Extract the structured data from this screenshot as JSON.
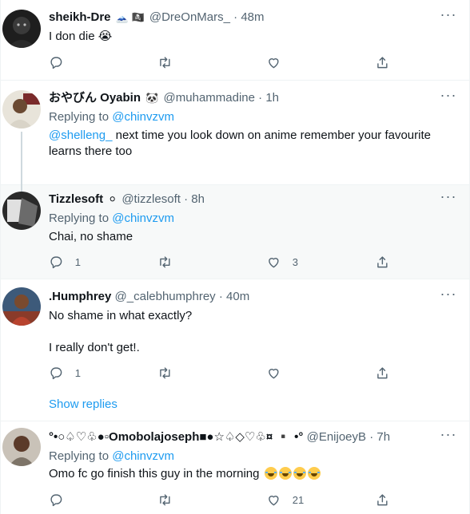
{
  "tweets": [
    {
      "name": "sheikh-Dre",
      "badges": "🗻 🏴‍☠️",
      "handle": "@DreOnMars_",
      "time": "48m",
      "lines": [
        "I don die 😭"
      ],
      "replies": "",
      "retweets": "",
      "likes": ""
    },
    {
      "name": "おやびん Oyabin",
      "badges": "🐼",
      "handle": "@muhammadine",
      "time": "1h",
      "replying_label": "Replying to",
      "replying_to": "@chinvzvm",
      "mention": "@shelleng_",
      "text_line1": " next time you look down on anime remember your favourite",
      "text_line2": "learns there too",
      "replies": "",
      "retweets": "",
      "likes": ""
    },
    {
      "name": "Tizzlesoft",
      "badges": "⚪",
      "handle": "@tizzlesoft",
      "time": "8h",
      "replying_label": "Replying to",
      "replying_to": "@chinvzvm",
      "text": "Chai, no shame",
      "replies": "1",
      "retweets": "",
      "likes": "3"
    },
    {
      "name": ".Humphrey",
      "handle": "@_calebhumphrey",
      "time": "40m",
      "text_line1": "No shame in what exactly?",
      "text_line2": "I really don't get!.",
      "replies": "1",
      "retweets": "",
      "likes": "",
      "show_replies": "Show replies"
    },
    {
      "name": "°•○♤♡♧●▫Omobolajoseph■●☆♤◇♡♧¤ ▪️ •°",
      "handle": "@EnijoeyB",
      "time": "7h",
      "replying_label": "Replying to",
      "replying_to": "@chinvzvm",
      "text": "Omo fc go finish this guy in the morning",
      "replies": "",
      "retweets": "",
      "likes": "21"
    }
  ],
  "separator": "·",
  "more_glyph": "···",
  "colors": {
    "link": "#1d9bf0",
    "secondary_text": "#536471",
    "primary_text": "#0f1419",
    "highlight_bg": "#f7f9f9",
    "border": "#eff3f4"
  },
  "icons": [
    "reply-icon",
    "retweet-icon",
    "like-icon",
    "share-icon",
    "more-icon"
  ]
}
